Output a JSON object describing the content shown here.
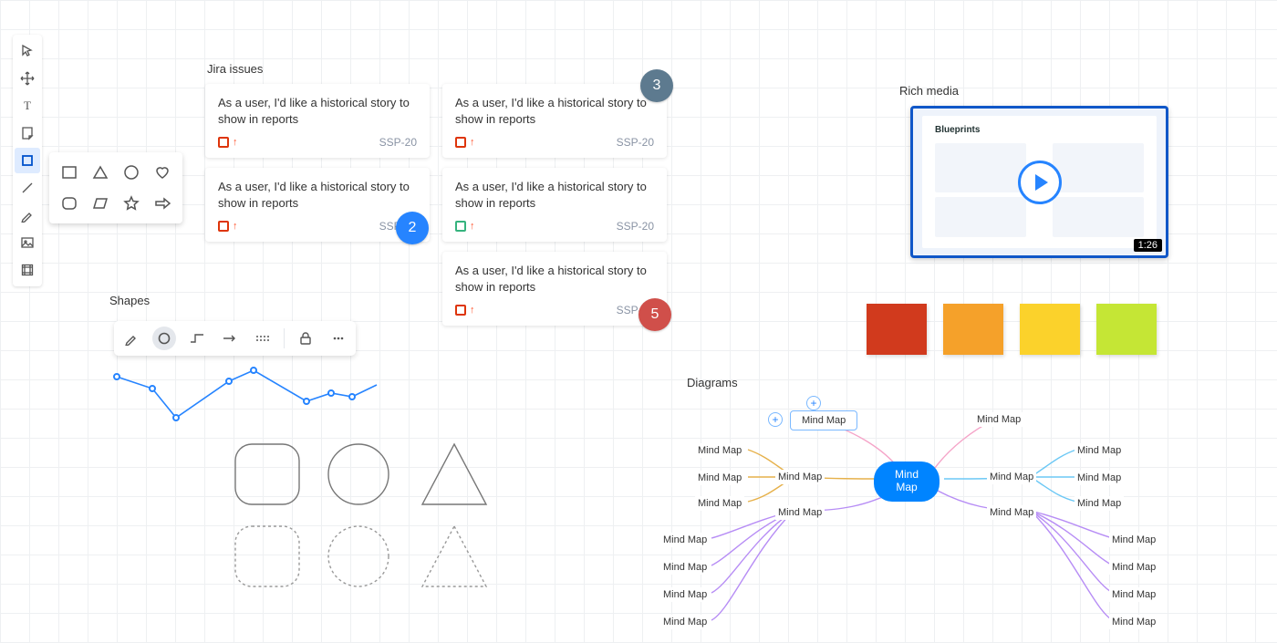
{
  "sections": {
    "jira": "Jira issues",
    "shapes": "Shapes",
    "rich": "Rich media",
    "diagrams": "Diagrams"
  },
  "jira_cards": [
    {
      "title": "As a user, I'd like a historical story to show in reports",
      "key": "SSP-20",
      "type": "red"
    },
    {
      "title": "As a user, I'd like a historical story to show in reports",
      "key": "SSP-20",
      "type": "red"
    },
    {
      "title": "As a user, I'd like a historical story to show in reports",
      "key": "SSP-20",
      "type": "red"
    },
    {
      "title": "As a user, I'd like a historical story to show in reports",
      "key": "SSP-20",
      "type": "green"
    },
    {
      "title": "As a user, I'd like a historical story to show in reports",
      "key": "SSP-20",
      "type": "red"
    }
  ],
  "badges": {
    "blue": {
      "num": "2",
      "color": "#2684ff"
    },
    "slate": {
      "num": "3",
      "color": "#5d7a8f"
    },
    "red": {
      "num": "5",
      "color": "#d04f4a"
    }
  },
  "video": {
    "duration": "1:26",
    "title": "Blueprints"
  },
  "stickies": [
    {
      "color": "#d13a1d"
    },
    {
      "color": "#f5a12a"
    },
    {
      "color": "#fbd22b"
    },
    {
      "color": "#c5e635"
    }
  ],
  "mindmap": {
    "center": "Mind Map",
    "label": "Mind Map"
  },
  "colors": {
    "accent": "#2684ff"
  }
}
